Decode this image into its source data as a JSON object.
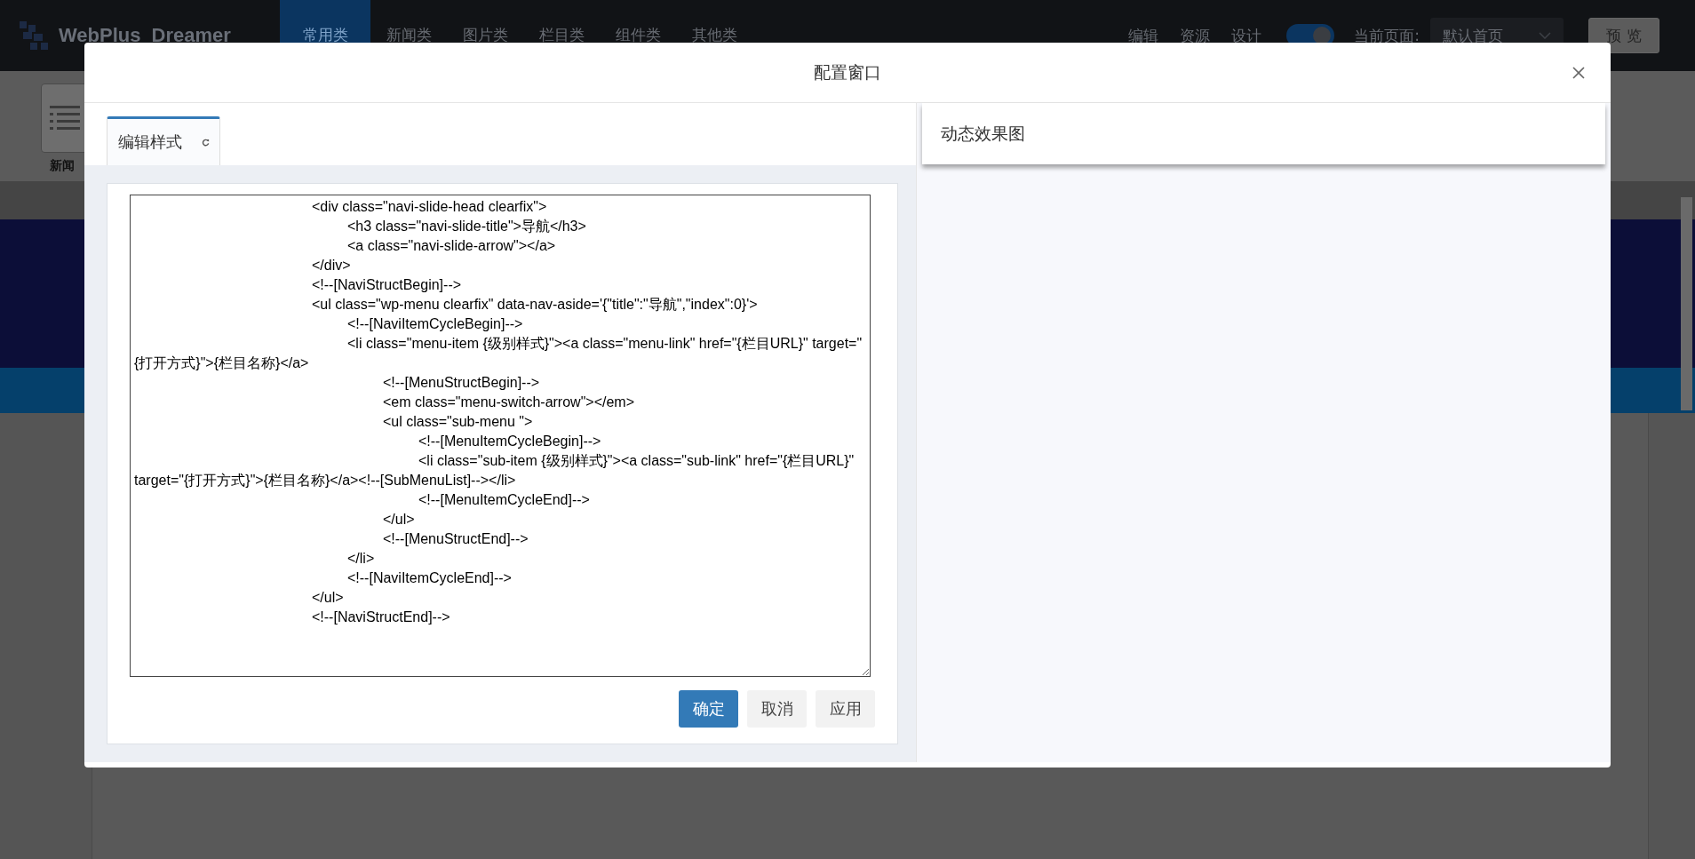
{
  "app_bar": {
    "logo": "WebPlus",
    "logo_suffix": "Dreamer",
    "tabs": [
      {
        "label": "常用类",
        "selected": true
      },
      {
        "label": "新闻类",
        "selected": false
      },
      {
        "label": "图片类",
        "selected": false
      },
      {
        "label": "栏目类",
        "selected": false
      },
      {
        "label": "组件类",
        "selected": false
      },
      {
        "label": "其他类",
        "selected": false
      }
    ],
    "menu": [
      "编辑",
      "资源",
      "设计"
    ],
    "toggle": {
      "on": true
    },
    "page_label": "当前页面:",
    "page_select": "默认首页",
    "preview_button": "预 览"
  },
  "left_panel": {
    "item_label": "新闻"
  },
  "dialog": {
    "title": "配置窗口",
    "tabs": [
      {
        "label": "编辑样式",
        "selected": true
      }
    ],
    "code": "\t\t\t\t\t<div class=\"navi-slide-head clearfix\">\n\t\t\t\t\t\t<h3 class=\"navi-slide-title\">导航</h3>\n\t\t\t\t\t\t<a class=\"navi-slide-arrow\"></a>\n\t\t\t\t\t</div>\n\t\t\t\t\t<!--[NaviStructBegin]-->\n\t\t\t\t\t<ul class=\"wp-menu clearfix\" data-nav-aside='{\"title\":\"导航\",\"index\":0}'>\n\t\t\t\t\t\t<!--[NaviItemCycleBegin]-->\n\t\t\t\t\t\t<li class=\"menu-item {级别样式}\"><a class=\"menu-link\" href=\"{栏目URL}\" target=\"{打开方式}\">{栏目名称}</a>\n\t\t\t\t\t\t\t<!--[MenuStructBegin]-->\n\t\t\t\t\t\t\t<em class=\"menu-switch-arrow\"></em>\n\t\t\t\t\t\t\t<ul class=\"sub-menu \">\n\t\t\t\t\t\t\t\t<!--[MenuItemCycleBegin]-->\n\t\t\t\t\t\t\t\t<li class=\"sub-item {级别样式}\"><a class=\"sub-link\" href=\"{栏目URL}\" target=\"{打开方式}\">{栏目名称}</a><!--[SubMenuList]--></li>\n\t\t\t\t\t\t\t\t<!--[MenuItemCycleEnd]-->\n\t\t\t\t\t\t\t</ul>\n\t\t\t\t\t\t\t<!--[MenuStructEnd]-->\n\t\t\t\t\t\t</li>\n\t\t\t\t\t\t<!--[NaviItemCycleEnd]-->\n\t\t\t\t\t</ul>\n\t\t\t\t\t<!--[NaviStructEnd]-->",
    "buttons": [
      {
        "label": "确定",
        "kind": "primary"
      },
      {
        "label": "取消",
        "kind": "default"
      },
      {
        "label": "应用",
        "kind": "default"
      }
    ],
    "preview_title": "动态效果图"
  }
}
